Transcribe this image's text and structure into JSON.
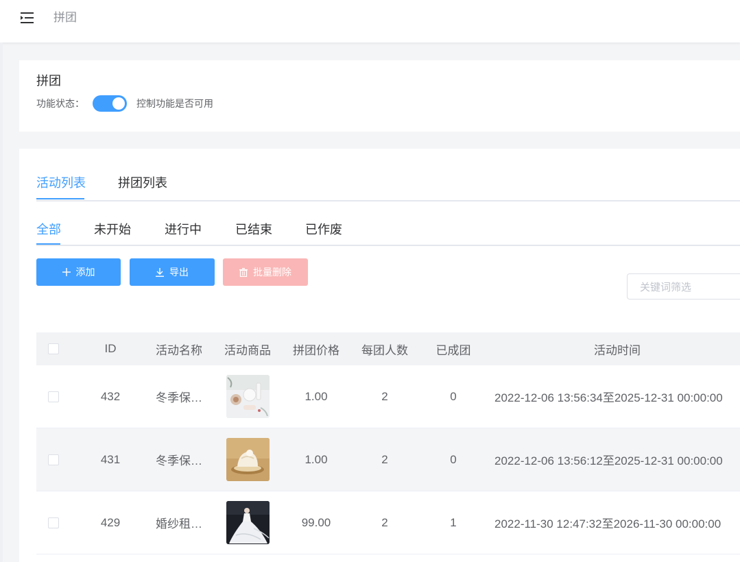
{
  "header": {
    "title": "拼团",
    "menu_icon": "menu-fold-icon"
  },
  "func_card": {
    "title": "拼团",
    "status_label": "功能状态：",
    "switch_on": true,
    "description": "控制功能是否可用"
  },
  "tabs": [
    {
      "label": "活动列表",
      "active": true
    },
    {
      "label": "拼团列表",
      "active": false
    }
  ],
  "subtabs": [
    {
      "label": "全部",
      "active": true
    },
    {
      "label": "未开始",
      "active": false
    },
    {
      "label": "进行中",
      "active": false
    },
    {
      "label": "已结束",
      "active": false
    },
    {
      "label": "已作废",
      "active": false
    }
  ],
  "toolbar": {
    "add_label": "添加",
    "export_label": "导出",
    "batch_delete_label": "批量删除"
  },
  "search": {
    "placeholder": "关键词筛选",
    "value": ""
  },
  "table": {
    "columns": [
      "ID",
      "活动名称",
      "活动商品",
      "拼团价格",
      "每团人数",
      "已成团",
      "活动时间"
    ],
    "rows": [
      {
        "id": "432",
        "name": "冬季保…",
        "product_image": "cosmetics-flatlay",
        "price": "1.00",
        "group_size": "2",
        "groups_done": "0",
        "time": "2022-12-06 13:56:34至2025-12-31 00:00:00"
      },
      {
        "id": "431",
        "name": "冬季保…",
        "product_image": "cake-on-gold",
        "price": "1.00",
        "group_size": "2",
        "groups_done": "0",
        "time": "2022-12-06 13:56:12至2025-12-31 00:00:00"
      },
      {
        "id": "429",
        "name": "婚纱租…",
        "product_image": "wedding-dress",
        "price": "99.00",
        "group_size": "2",
        "groups_done": "1",
        "time": "2022-11-30 12:47:32至2026-11-30 00:00:00"
      }
    ]
  },
  "colors": {
    "primary": "#409eff",
    "danger_disabled": "#fab6b6"
  }
}
